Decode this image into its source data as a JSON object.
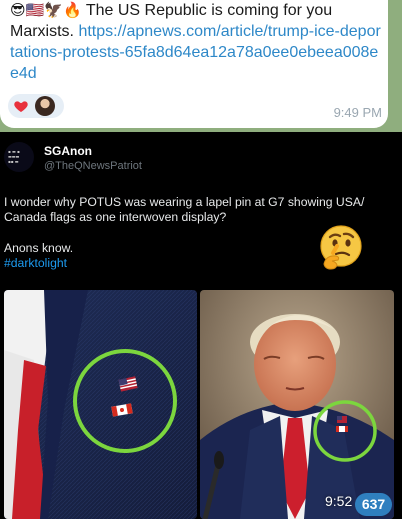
{
  "message": {
    "emoji_prefix": "😎🇺🇸🦅🔥",
    "text": "The US Republic is coming for you Marxists.",
    "link": "https://apnews.com/article/trump-ice-deportations-protests-65fa8d64ea12a78a0ee0ebeea008ee4d",
    "time": "9:49 PM",
    "reactions": [
      "heart-icon",
      "user-avatar"
    ]
  },
  "tweet": {
    "author_name": "SGAnon",
    "author_handle": "@TheQNewsPatriot",
    "body_line1": "I wonder why POTUS was wearing a lapel pin at G7 showing USA/ Canada flags as one interwoven display?",
    "body_line2": "Anons know.",
    "hashtag": "#darktolight",
    "emoji": "thinking-face-icon"
  },
  "post": {
    "time": "9:52",
    "views": "637"
  },
  "colors": {
    "chat_background": "#8fae7e",
    "link": "#2e88c8",
    "hashtag": "#1d9bf0",
    "badge": "#2f7fbf"
  }
}
